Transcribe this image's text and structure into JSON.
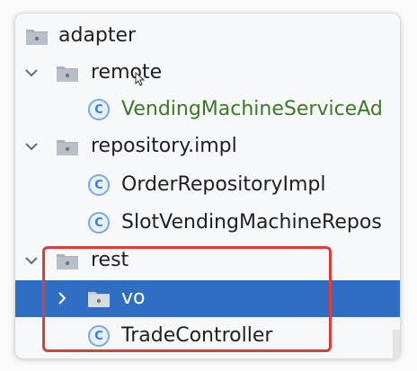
{
  "tree": {
    "items": [
      {
        "label": "adapter",
        "kind": "package",
        "expanded": true,
        "selected": false
      },
      {
        "label": "remote",
        "kind": "package",
        "expanded": true,
        "selected": false
      },
      {
        "label": "VendingMachineServiceAd",
        "kind": "class",
        "selected": false,
        "text_color": "#3a7a25"
      },
      {
        "label": "repository.impl",
        "kind": "package",
        "expanded": true,
        "selected": false
      },
      {
        "label": "OrderRepositoryImpl",
        "kind": "class",
        "selected": false
      },
      {
        "label": "SlotVendingMachineRepos",
        "kind": "class",
        "selected": false
      },
      {
        "label": "rest",
        "kind": "package",
        "expanded": true,
        "selected": false
      },
      {
        "label": "vo",
        "kind": "package",
        "expanded": false,
        "selected": true
      },
      {
        "label": "TradeController",
        "kind": "class",
        "selected": false
      }
    ],
    "class_badge": "C",
    "selection_color": "#2f6ec2",
    "highlight_color": "#e23b3b"
  }
}
